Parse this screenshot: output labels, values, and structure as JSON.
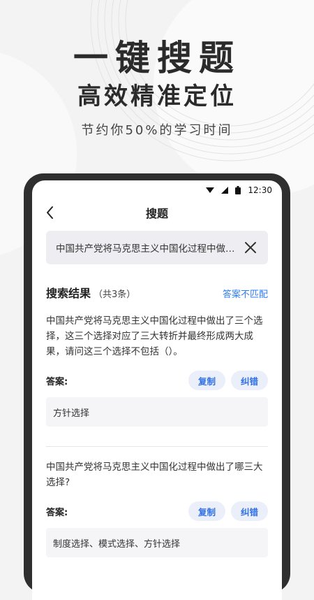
{
  "hero": {
    "title": "一键搜题",
    "subtitle": "高效精准定位",
    "caption": "节约你50%的学习时间"
  },
  "statusbar": {
    "time": "12:30"
  },
  "nav": {
    "title": "搜题"
  },
  "search": {
    "query": "中国共产党将马克思主义中国化过程中做出了三个选择"
  },
  "results": {
    "title": "搜索结果",
    "count": "（共3条）",
    "mismatch": "答案不匹配",
    "items": [
      {
        "question": "中国共产党将马克思主义中国化过程中做出了三个选择，这三个选择对应了三大转折并最终形成两大成果，请问这三个选择不包括（）。",
        "answer_label": "答案:",
        "copy_label": "复制",
        "report_label": "纠错",
        "answer": "方针选择"
      },
      {
        "question": "中国共产党将马克思主义中国化过程中做出了哪三大选择?",
        "answer_label": "答案:",
        "copy_label": "复制",
        "report_label": "纠错",
        "answer": "制度选择、模式选择、方针选择"
      }
    ]
  },
  "colors": {
    "accent": "#2f7cf6",
    "pill_bg": "#ebeff9",
    "frame": "#2f2f2f"
  }
}
